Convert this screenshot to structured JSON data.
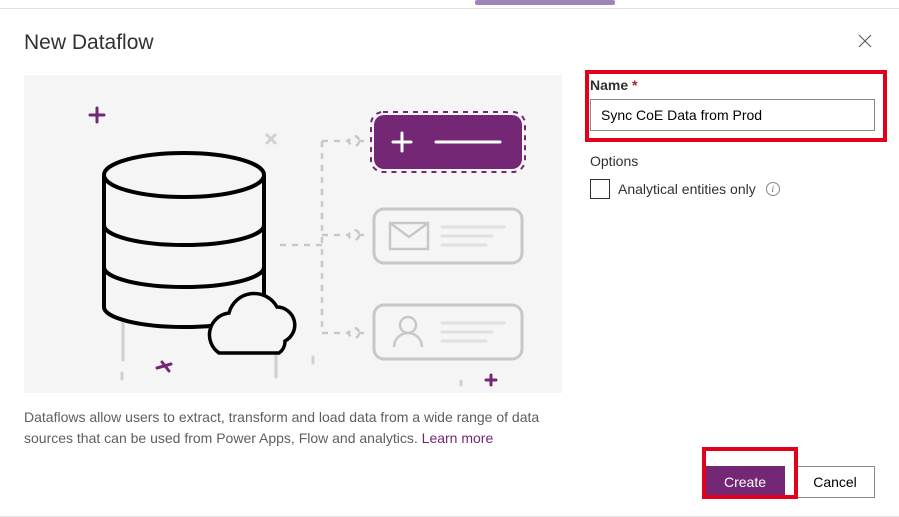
{
  "header": {
    "title": "New Dataflow"
  },
  "form": {
    "name_label": "Name",
    "name_required": "*",
    "name_value": "Sync CoE Data from Prod",
    "options_heading": "Options",
    "analytical_label": "Analytical entities only"
  },
  "description": {
    "text1": "Dataflows allow users to extract, transform and load data from a wide range of data sources that can be used from Power Apps, Flow and analytics. ",
    "learn_more": "Learn more"
  },
  "footer": {
    "create": "Create",
    "cancel": "Cancel"
  }
}
